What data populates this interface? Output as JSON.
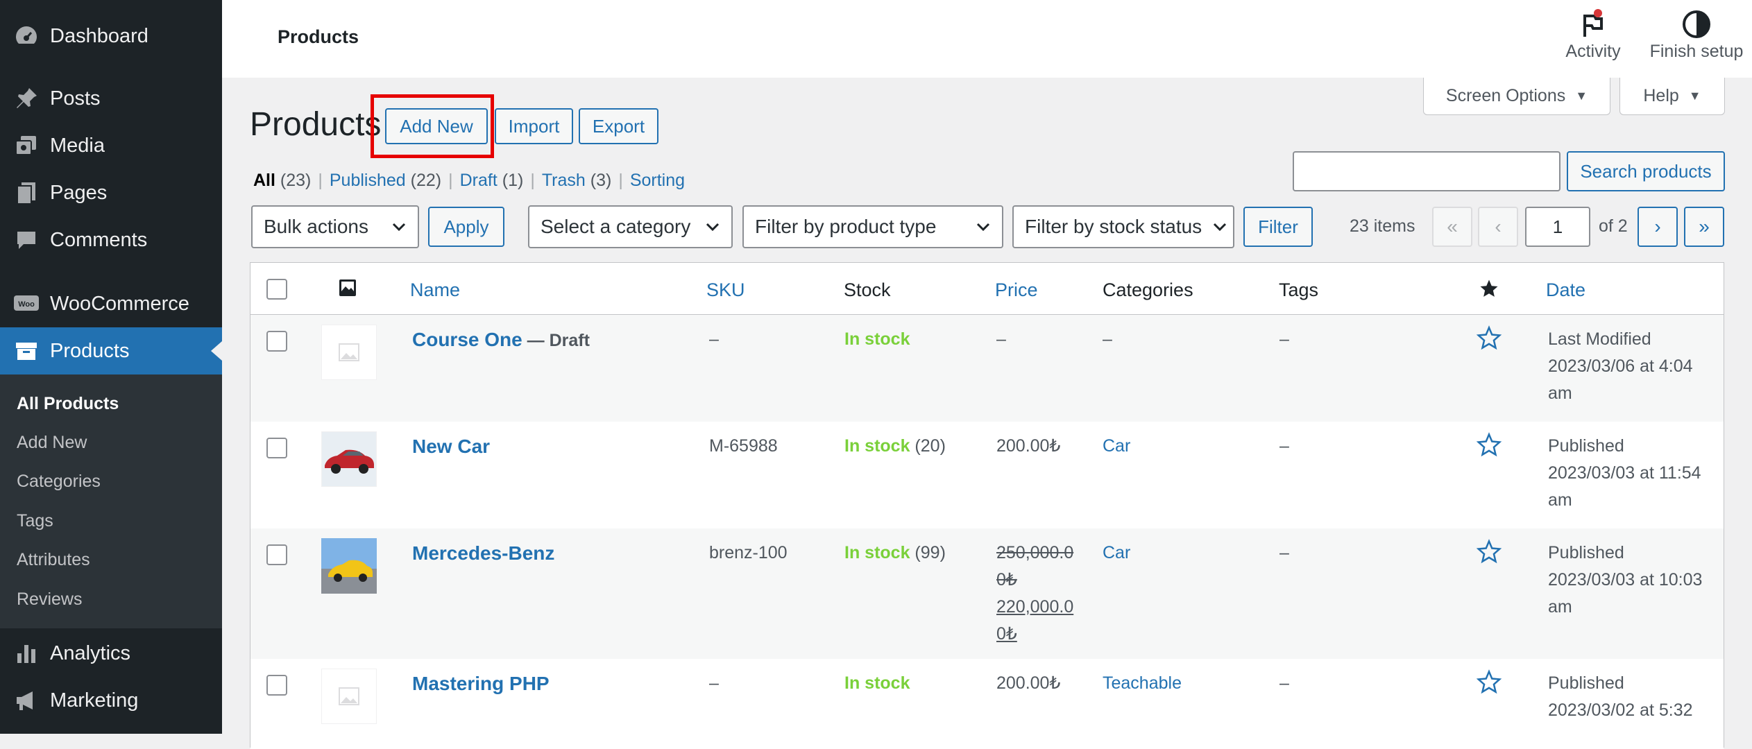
{
  "sidebar": {
    "menu": [
      {
        "label": "Dashboard",
        "icon": "dashboard-icon"
      },
      {
        "label": "Posts",
        "icon": "pin-icon"
      },
      {
        "label": "Media",
        "icon": "media-icon"
      },
      {
        "label": "Pages",
        "icon": "pages-icon"
      },
      {
        "label": "Comments",
        "icon": "comment-icon"
      },
      {
        "label": "WooCommerce",
        "icon": "woocommerce-icon"
      },
      {
        "label": "Products",
        "icon": "archive-icon"
      },
      {
        "label": "Analytics",
        "icon": "bar-chart-icon"
      },
      {
        "label": "Marketing",
        "icon": "megaphone-icon"
      }
    ],
    "submenu": [
      "All Products",
      "Add New",
      "Categories",
      "Tags",
      "Attributes",
      "Reviews"
    ]
  },
  "topbar": {
    "title": "Products",
    "activity": "Activity",
    "finish_setup": "Finish setup"
  },
  "screen_options": "Screen Options",
  "help": "Help",
  "heading": "Products",
  "actions": {
    "add_new": "Add New",
    "import": "Import",
    "export": "Export"
  },
  "views": [
    {
      "label": "All",
      "count": "(23)"
    },
    {
      "label": "Published",
      "count": "(22)"
    },
    {
      "label": "Draft",
      "count": "(1)"
    },
    {
      "label": "Trash",
      "count": "(3)"
    },
    {
      "label": "Sorting",
      "count": ""
    }
  ],
  "search": {
    "value": "",
    "button": "Search products"
  },
  "filters": {
    "bulk_actions": "Bulk actions",
    "apply": "Apply",
    "category": "Select a category",
    "product_type": "Filter by product type",
    "stock_status": "Filter by stock status",
    "filter": "Filter"
  },
  "pagination": {
    "items": "23 items",
    "first": "«",
    "prev": "‹",
    "current": "1",
    "of": "of 2",
    "next": "›",
    "last": "»"
  },
  "table": {
    "columns": {
      "name": "Name",
      "sku": "SKU",
      "stock": "Stock",
      "price": "Price",
      "categories": "Categories",
      "tags": "Tags",
      "date": "Date"
    },
    "rows": [
      {
        "name": "Course One",
        "state": " — Draft",
        "sku": "–",
        "stock": "In stock",
        "stock_qty": "",
        "price": "–",
        "category": "–",
        "tags": "–",
        "date_status": "Last Modified",
        "date_line1": "2023/03/06 at 4:04",
        "date_line2": "am"
      },
      {
        "name": "New Car",
        "state": "",
        "sku": "M-65988",
        "stock": "In stock",
        "stock_qty": " (20)",
        "price": "200.00₺",
        "category": "Car",
        "tags": "–",
        "date_status": "Published",
        "date_line1": "2023/03/03 at 11:54",
        "date_line2": "am"
      },
      {
        "name": "Mercedes-Benz",
        "state": "",
        "sku": "brenz-100",
        "stock": "In stock",
        "stock_qty": " (99)",
        "price_old": "250,000.00₺",
        "price_new": "220,000.00₺",
        "category": "Car",
        "tags": "–",
        "date_status": "Published",
        "date_line1": "2023/03/03 at 10:03",
        "date_line2": "am"
      },
      {
        "name": "Mastering PHP",
        "state": "",
        "sku": "–",
        "stock": "In stock",
        "stock_qty": "",
        "price": "200.00₺",
        "category": "Teachable",
        "tags": "–",
        "date_status": "Published",
        "date_line1": "2023/03/02 at 5:32",
        "date_line2": ""
      }
    ]
  },
  "colors": {
    "sidebar": "#1d2327",
    "accent": "#2271b1",
    "stock": "#7ad03a",
    "highlight": "#e60000"
  }
}
